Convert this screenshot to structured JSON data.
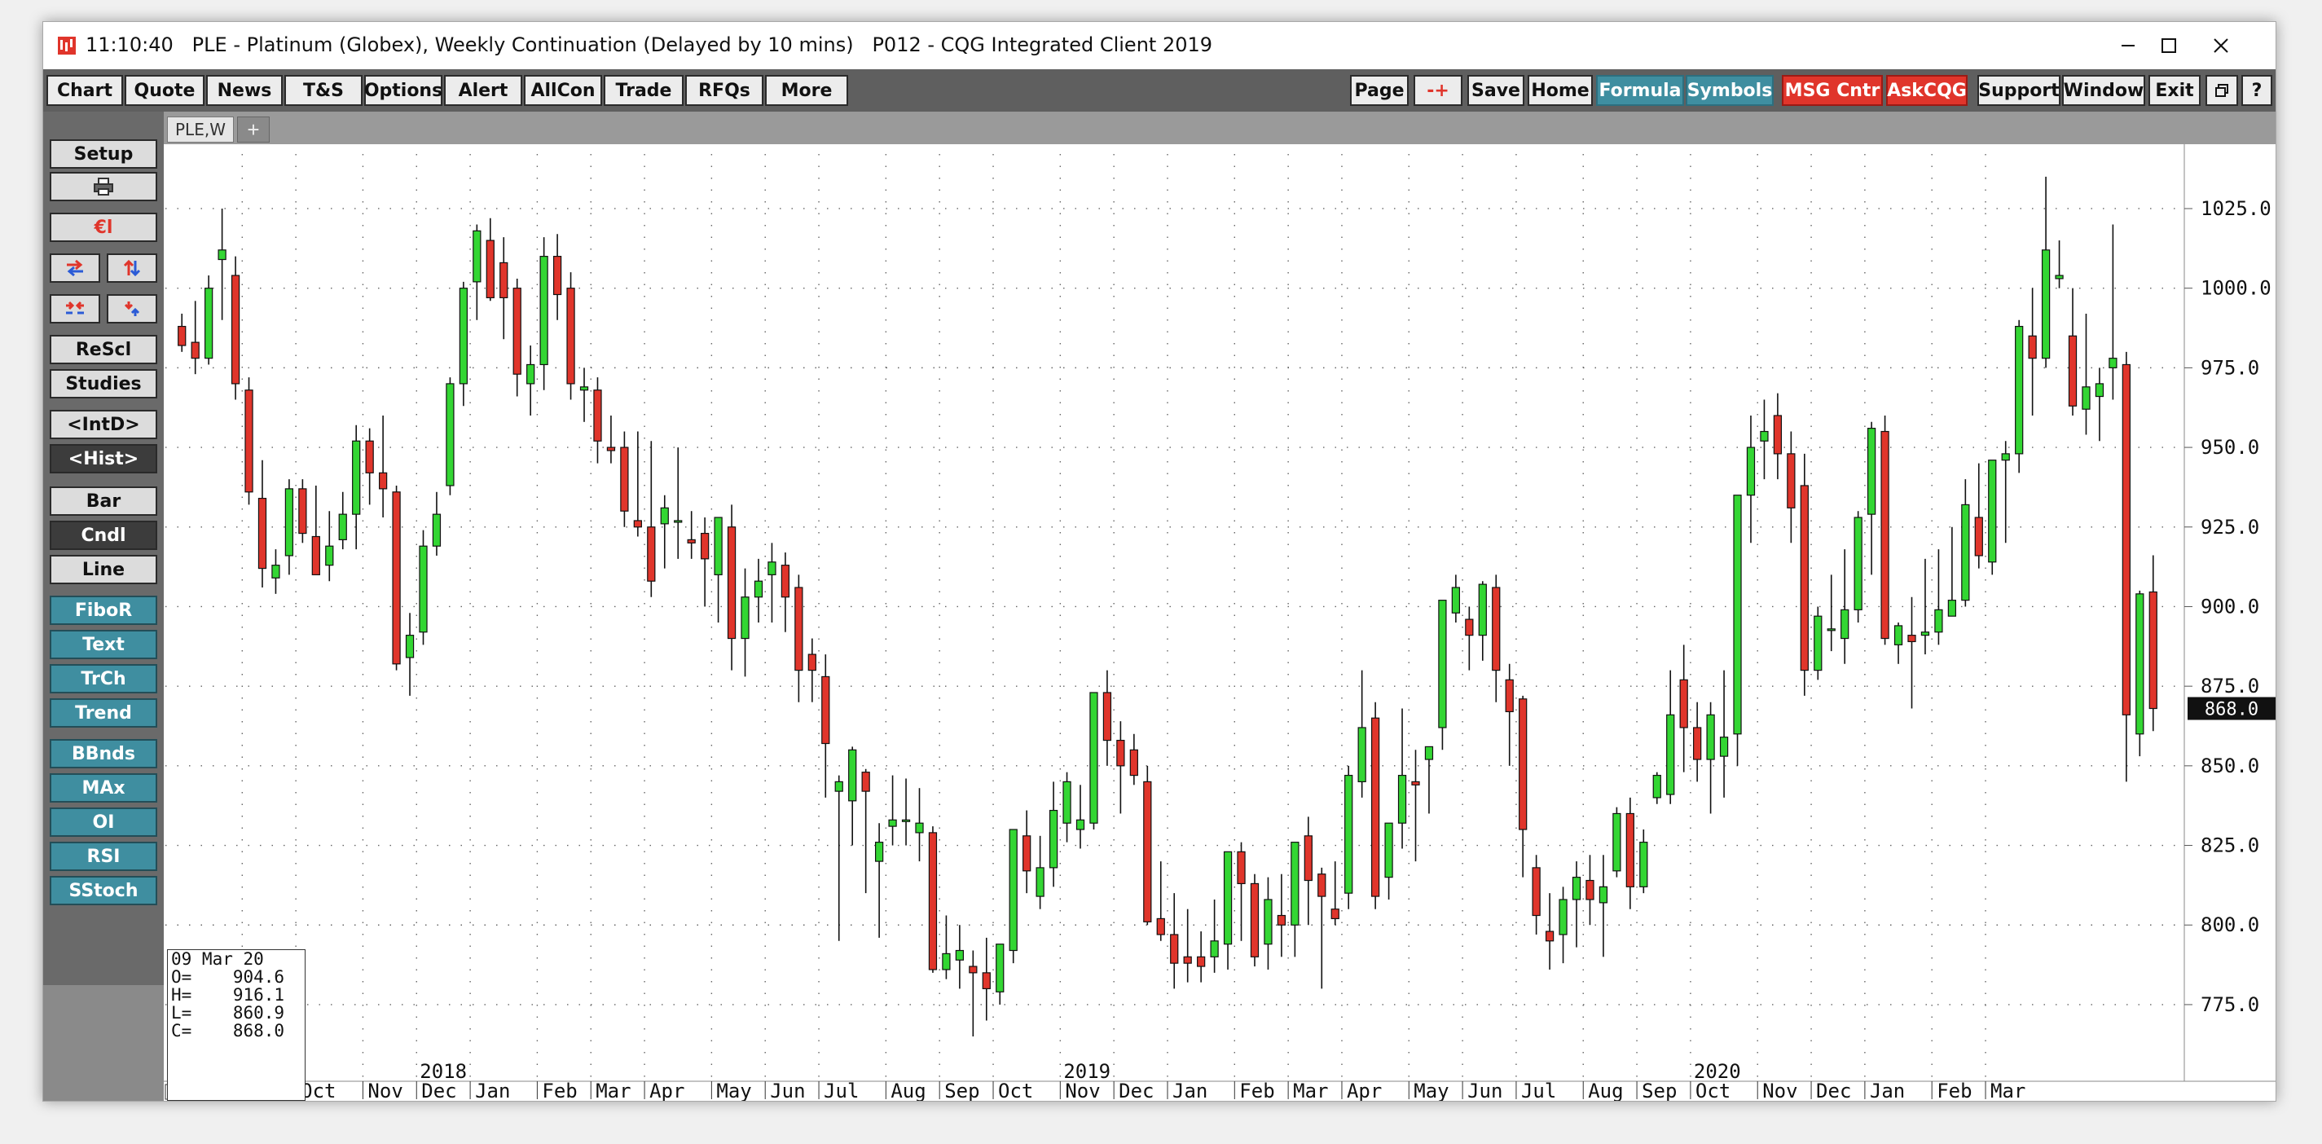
{
  "window": {
    "title": "11:10:40   PLE - Platinum (Globex), Weekly Continuation (Delayed by 10 mins)   P012 - CQG Integrated Client 2019"
  },
  "toolbar": {
    "left": [
      "Chart",
      "Quote",
      "News",
      "T&S",
      "Options",
      "Alert",
      "AllCon",
      "Trade",
      "RFQs",
      "More"
    ],
    "right": [
      {
        "label": "Page",
        "style": "plain"
      },
      {
        "label": "-+",
        "style": "plain"
      },
      {
        "label": "Save",
        "style": "plain"
      },
      {
        "label": "Home",
        "style": "plain"
      },
      {
        "label": "Formula",
        "style": "teal"
      },
      {
        "label": "Symbols",
        "style": "teal"
      },
      {
        "label": "MSG Cntr",
        "style": "red"
      },
      {
        "label": "AskCQG",
        "style": "red"
      },
      {
        "label": "Support",
        "style": "plain"
      },
      {
        "label": "Window",
        "style": "plain"
      },
      {
        "label": "Exit",
        "style": "plain"
      }
    ]
  },
  "tabs": {
    "active": "PLE,W",
    "add": "+"
  },
  "sidebar": {
    "setup": "Setup",
    "rescl": "ReScl",
    "studies": "Studies",
    "intd": "<IntD>",
    "hist": "<Hist>",
    "bar": "Bar",
    "cndl": "Cndl",
    "line": "Line",
    "tools": [
      "FiboR",
      "Text",
      "TrCh",
      "Trend",
      "BBnds",
      "MAx",
      "OI",
      "RSI",
      "SStoch"
    ]
  },
  "ohlc": {
    "date": "09 Mar 20",
    "open": "O=    904.6",
    "high": "H=    916.1",
    "low": "L=    860.9",
    "close": "C=    868.0"
  },
  "chart_data": {
    "type": "candlestick",
    "symbol": "PLE,W",
    "y_range": [
      754,
      1036
    ],
    "y_ticks": [
      775,
      800,
      825,
      850,
      875,
      900,
      925,
      950,
      975,
      1000,
      1025
    ],
    "last_price": "868.0",
    "up_color": "#33d633",
    "down_color": "#e0352b",
    "month_labels": [
      "Sep",
      "Oct",
      "Nov",
      "Dec",
      "Jan",
      "Feb",
      "Mar",
      "Apr",
      "May",
      "Jun",
      "Jul",
      "Aug",
      "Sep",
      "Oct",
      "Nov",
      "Dec",
      "Jan",
      "Feb",
      "Mar",
      "Apr",
      "May",
      "Jun",
      "Jul",
      "Aug",
      "Sep",
      "Oct",
      "Nov",
      "Dec",
      "Jan",
      "Feb",
      "Mar"
    ],
    "year_labels": [
      "2018",
      "2019",
      "2020"
    ],
    "candles": [
      [
        988,
        992,
        980,
        982
      ],
      [
        983,
        996,
        973,
        978
      ],
      [
        978,
        1004,
        976,
        1000
      ],
      [
        1009,
        1025,
        990,
        1012
      ],
      [
        1004,
        1010,
        965,
        970
      ],
      [
        968,
        972,
        932,
        936
      ],
      [
        934,
        946,
        906,
        912
      ],
      [
        909,
        918,
        904,
        913
      ],
      [
        916,
        940,
        910,
        937
      ],
      [
        937,
        940,
        920,
        923
      ],
      [
        922,
        938,
        910,
        910
      ],
      [
        913,
        930,
        908,
        919
      ],
      [
        921,
        936,
        918,
        929
      ],
      [
        929,
        957,
        918,
        952
      ],
      [
        952,
        956,
        932,
        942
      ],
      [
        942,
        960,
        928,
        937
      ],
      [
        936,
        938,
        880,
        882
      ],
      [
        884,
        898,
        872,
        891
      ],
      [
        892,
        924,
        888,
        919
      ],
      [
        919,
        936,
        916,
        929
      ],
      [
        938,
        972,
        935,
        970
      ],
      [
        970,
        1002,
        963,
        1000
      ],
      [
        1002,
        1020,
        990,
        1018
      ],
      [
        1015,
        1022,
        996,
        997
      ],
      [
        1008,
        1016,
        984,
        997
      ],
      [
        1000,
        1003,
        966,
        973
      ],
      [
        970,
        982,
        960,
        976
      ],
      [
        976,
        1016,
        968,
        1010
      ],
      [
        1010,
        1017,
        990,
        998
      ],
      [
        1000,
        1005,
        965,
        970
      ],
      [
        968,
        975,
        958,
        969
      ],
      [
        968,
        972,
        945,
        952
      ],
      [
        950,
        960,
        945,
        949
      ],
      [
        950,
        955,
        925,
        930
      ],
      [
        927,
        955,
        922,
        925
      ],
      [
        925,
        952,
        903,
        908
      ],
      [
        926,
        935,
        912,
        931
      ],
      [
        927,
        950,
        915,
        927
      ],
      [
        921,
        930,
        915,
        920
      ],
      [
        923,
        928,
        900,
        915
      ],
      [
        910,
        928,
        895,
        928
      ],
      [
        925,
        932,
        880,
        890
      ],
      [
        890,
        912,
        878,
        903
      ],
      [
        903,
        915,
        895,
        908
      ],
      [
        910,
        920,
        895,
        914
      ],
      [
        913,
        917,
        892,
        903
      ],
      [
        906,
        910,
        870,
        880
      ],
      [
        885,
        890,
        870,
        880
      ],
      [
        878,
        885,
        840,
        857
      ],
      [
        842,
        847,
        795,
        845
      ],
      [
        839,
        856,
        825,
        855
      ],
      [
        848,
        849,
        810,
        842
      ],
      [
        820,
        832,
        796,
        826
      ],
      [
        831,
        847,
        825,
        833
      ],
      [
        833,
        846,
        825,
        833
      ],
      [
        829,
        843,
        820,
        832
      ],
      [
        829,
        831,
        785,
        786
      ],
      [
        786,
        803,
        783,
        791
      ],
      [
        789,
        800,
        780,
        792
      ],
      [
        787,
        792,
        765,
        785
      ],
      [
        785,
        796,
        770,
        780
      ],
      [
        779,
        788,
        775,
        794
      ],
      [
        792,
        830,
        788,
        830
      ],
      [
        828,
        836,
        810,
        817
      ],
      [
        809,
        828,
        805,
        818
      ],
      [
        818,
        845,
        812,
        836
      ],
      [
        832,
        848,
        826,
        845
      ],
      [
        830,
        844,
        824,
        833
      ],
      [
        832,
        872,
        830,
        873
      ],
      [
        873,
        880,
        850,
        858
      ],
      [
        858,
        864,
        835,
        850
      ],
      [
        855,
        860,
        844,
        847
      ],
      [
        845,
        850,
        800,
        801
      ],
      [
        802,
        820,
        795,
        797
      ],
      [
        797,
        810,
        780,
        788
      ],
      [
        790,
        805,
        782,
        788
      ],
      [
        790,
        798,
        782,
        787
      ],
      [
        790,
        808,
        785,
        795
      ],
      [
        794,
        805,
        786,
        823
      ],
      [
        823,
        826,
        795,
        813
      ],
      [
        813,
        816,
        787,
        790
      ],
      [
        794,
        815,
        786,
        808
      ],
      [
        803,
        816,
        790,
        800
      ],
      [
        800,
        826,
        790,
        826
      ],
      [
        828,
        834,
        800,
        814
      ],
      [
        816,
        818,
        780,
        809
      ],
      [
        805,
        820,
        800,
        802
      ],
      [
        810,
        850,
        805,
        847
      ],
      [
        845,
        880,
        840,
        862
      ],
      [
        865,
        870,
        805,
        809
      ],
      [
        815,
        830,
        808,
        832
      ],
      [
        832,
        868,
        824,
        847
      ],
      [
        845,
        855,
        820,
        844
      ],
      [
        852,
        856,
        835,
        856
      ],
      [
        862,
        902,
        855,
        902
      ],
      [
        898,
        910,
        895,
        906
      ],
      [
        896,
        900,
        880,
        891
      ],
      [
        891,
        908,
        883,
        907
      ],
      [
        906,
        910,
        870,
        880
      ],
      [
        877,
        882,
        850,
        867
      ],
      [
        871,
        872,
        815,
        830
      ],
      [
        818,
        822,
        797,
        803
      ],
      [
        798,
        810,
        786,
        795
      ],
      [
        797,
        812,
        788,
        808
      ],
      [
        808,
        820,
        793,
        815
      ],
      [
        814,
        822,
        800,
        808
      ],
      [
        807,
        822,
        790,
        812
      ],
      [
        817,
        837,
        815,
        835
      ],
      [
        835,
        840,
        805,
        812
      ],
      [
        812,
        830,
        810,
        826
      ],
      [
        840,
        848,
        838,
        847
      ],
      [
        841,
        880,
        838,
        866
      ],
      [
        877,
        888,
        848,
        862
      ],
      [
        862,
        870,
        845,
        852
      ],
      [
        852,
        870,
        835,
        866
      ],
      [
        853,
        880,
        840,
        859
      ],
      [
        860,
        935,
        850,
        935
      ],
      [
        935,
        960,
        920,
        950
      ],
      [
        952,
        965,
        940,
        955
      ],
      [
        960,
        967,
        940,
        948
      ],
      [
        948,
        955,
        920,
        931
      ],
      [
        938,
        948,
        872,
        880
      ],
      [
        880,
        900,
        877,
        897
      ],
      [
        893,
        910,
        886,
        893
      ],
      [
        890,
        918,
        882,
        899
      ],
      [
        899,
        930,
        895,
        928
      ],
      [
        929,
        958,
        910,
        956
      ],
      [
        955,
        960,
        888,
        890
      ],
      [
        888,
        895,
        882,
        894
      ],
      [
        891,
        903,
        868,
        889
      ],
      [
        891,
        915,
        885,
        892
      ],
      [
        892,
        918,
        888,
        899
      ],
      [
        897,
        925,
        897,
        902
      ],
      [
        902,
        940,
        900,
        932
      ],
      [
        928,
        945,
        912,
        916
      ],
      [
        914,
        945,
        910,
        946
      ],
      [
        946,
        952,
        920,
        948
      ],
      [
        948,
        990,
        942,
        988
      ],
      [
        985,
        1000,
        960,
        978
      ],
      [
        978,
        1035,
        975,
        1012
      ],
      [
        1003,
        1015,
        1000,
        1004
      ],
      [
        985,
        1000,
        960,
        963
      ],
      [
        962,
        992,
        954,
        969
      ],
      [
        966,
        975,
        952,
        970
      ],
      [
        975,
        1020,
        965,
        978
      ],
      [
        976,
        980,
        845,
        866
      ],
      [
        860,
        905,
        853,
        904
      ],
      [
        904.6,
        916.1,
        860.9,
        868.0
      ]
    ]
  }
}
